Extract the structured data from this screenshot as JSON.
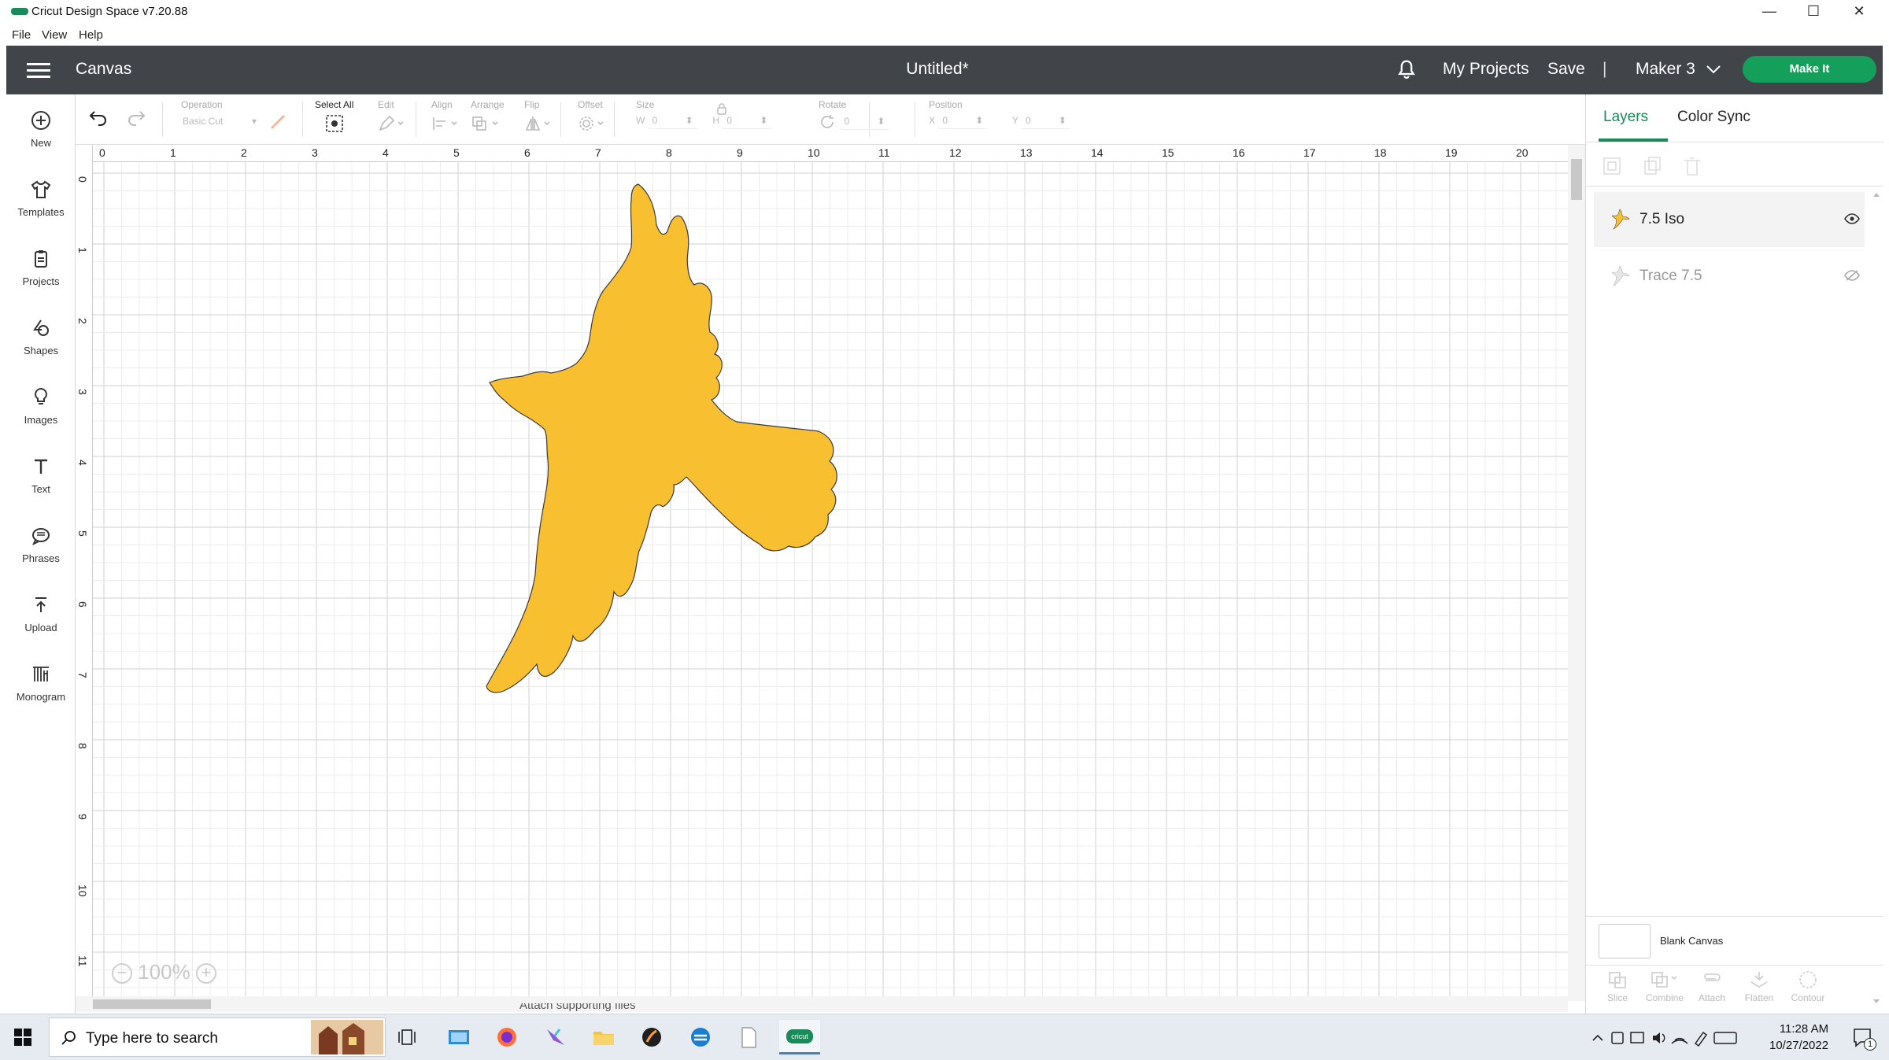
{
  "window": {
    "title": "Cricut Design Space  v7.20.88",
    "minimize": "—",
    "maximize": "☐",
    "close": "✕"
  },
  "menu": [
    "File",
    "View",
    "Help"
  ],
  "header": {
    "canvas_label": "Canvas",
    "doc_title": "Untitled*",
    "my_projects": "My Projects",
    "save": "Save",
    "separator": "|",
    "machine": "Maker 3",
    "make_it": "Make It"
  },
  "left_tools": [
    "New",
    "Templates",
    "Projects",
    "Shapes",
    "Images",
    "Text",
    "Phrases",
    "Upload",
    "Monogram"
  ],
  "edit_toolbar": {
    "operation_label": "Operation",
    "operation_value": "Basic Cut",
    "select_all": "Select All",
    "edit": "Edit",
    "align": "Align",
    "arrange": "Arrange",
    "flip": "Flip",
    "offset": "Offset",
    "size": "Size",
    "w": "W",
    "h": "H",
    "rotate": "Rotate",
    "position": "Position",
    "x": "X",
    "y": "Y",
    "w_value": "0",
    "h_value": "0",
    "rotate_value": "0",
    "x_value": "0",
    "y_value": "0"
  },
  "rulers": {
    "top": [
      "0",
      "1",
      "2",
      "3",
      "4",
      "5",
      "6",
      "7",
      "8",
      "9",
      "10",
      "11",
      "12",
      "13",
      "14",
      "15",
      "16",
      "17",
      "18",
      "19",
      "20"
    ],
    "left": [
      "0",
      "1",
      "2",
      "3",
      "4",
      "5",
      "6",
      "7",
      "8",
      "9",
      "10",
      "11"
    ]
  },
  "canvas": {
    "zoom": "100%",
    "shape_color": "#f8bf30",
    "shape_outline": "#3a3a3a"
  },
  "right_panel": {
    "tabs": [
      "Layers",
      "Color Sync"
    ],
    "layers": [
      {
        "name": "7.5 Iso",
        "visible": true
      },
      {
        "name": "Trace 7.5",
        "visible": false
      }
    ],
    "blank_canvas": "Blank Canvas",
    "bottom_buttons": [
      "Slice",
      "Combine",
      "Attach",
      "Flatten",
      "Contour"
    ]
  },
  "taskbar": {
    "search_placeholder": "Type here to search",
    "time": "11:28 AM",
    "date": "10/27/2022",
    "app_label": "cricut",
    "notification_count": "1"
  },
  "bottom_partial_text": "Attach supporting files"
}
